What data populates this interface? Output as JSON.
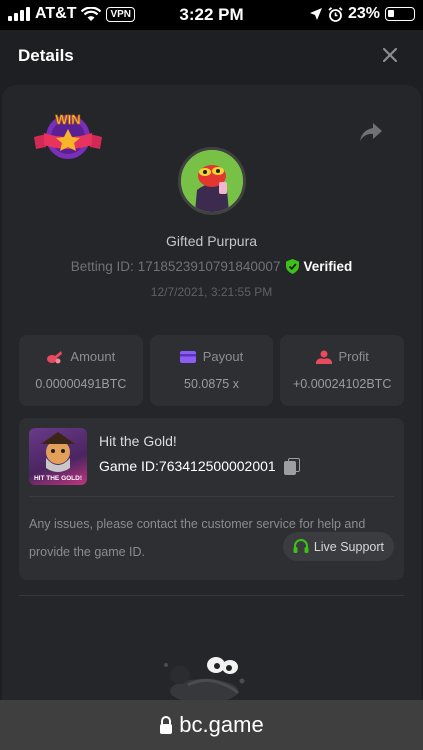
{
  "status_bar": {
    "carrier": "AT&T",
    "vpn": "VPN",
    "time": "3:22 PM",
    "battery": "23%",
    "battery_level": 0.23
  },
  "modal": {
    "title": "Details"
  },
  "bet": {
    "badge_text": "WIN",
    "username": "Gifted Purpura",
    "betting_id_label": "Betting ID:",
    "betting_id": "1718523910791840007",
    "verified_label": "Verified",
    "date": "12/7/2021, 3:21:55 PM"
  },
  "stats": [
    {
      "label": "Amount",
      "value": "0.00000491BTC",
      "icon": "coins-icon",
      "icon_color": "#e84a5f"
    },
    {
      "label": "Payout",
      "value": "50.0875 x",
      "icon": "card-icon",
      "icon_color": "#8b5cf6"
    },
    {
      "label": "Profit",
      "value": "+0.00024102BTC",
      "icon": "profit-icon",
      "icon_color": "#e84a5f"
    }
  ],
  "game": {
    "title": "Hit the Gold!",
    "thumb_label": "HIT THE GOLD!",
    "id_label": "Game ID:",
    "id": "763412500002001",
    "support_text": "Any issues, please contact the customer service for help and provide the game ID.",
    "live_support_label": "Live Support"
  },
  "browser": {
    "url": "bc.game"
  },
  "colors": {
    "accent_green": "#3bc117",
    "background": "#1e1f22",
    "card": "#2d2f33"
  }
}
